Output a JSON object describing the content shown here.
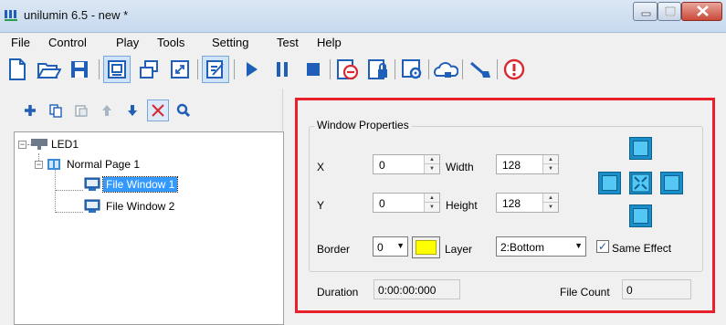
{
  "window": {
    "title": "unilumin 6.5 - new *"
  },
  "menu": {
    "items": [
      "File",
      "Control",
      "Play",
      "Tools",
      "Setting",
      "Test",
      "Help"
    ]
  },
  "toolbar": {
    "buttons": [
      "new-file-icon",
      "open-folder-icon",
      "save-icon",
      "screen-icon",
      "window-icon",
      "fullscreen-icon",
      "edit-icon",
      "play-icon",
      "pause-icon",
      "stop-icon",
      "timer-icon",
      "lock-icon",
      "settings-icon",
      "cloud-icon",
      "brush-icon",
      "info-icon"
    ],
    "accent": "#1f5fb8",
    "alert": "#d9282f"
  },
  "tree_toolbar": {
    "buttons": [
      "add-icon",
      "copy-icon",
      "paste-icon",
      "move-up-icon",
      "move-down-icon",
      "delete-icon",
      "search-icon"
    ]
  },
  "tree": {
    "led": "LED1",
    "page": "Normal Page 1",
    "windows": [
      "File Window 1",
      "File Window 2"
    ],
    "selected": "File Window 1"
  },
  "properties": {
    "group_title": "Window Properties",
    "x_label": "X",
    "x_value": "0",
    "width_label": "Width",
    "width_value": "128",
    "y_label": "Y",
    "y_value": "0",
    "height_label": "Height",
    "height_value": "128",
    "border_label": "Border",
    "border_value": "0",
    "border_color": "#ffff00",
    "layer_label": "Layer",
    "layer_value": "2:Bottom",
    "same_effect_label": "Same Effect",
    "same_effect_checked": true,
    "duration_label": "Duration",
    "duration_value": "0:00:00:000",
    "file_count_label": "File Count",
    "file_count_value": "0",
    "highlight_color": "#e8202a"
  }
}
